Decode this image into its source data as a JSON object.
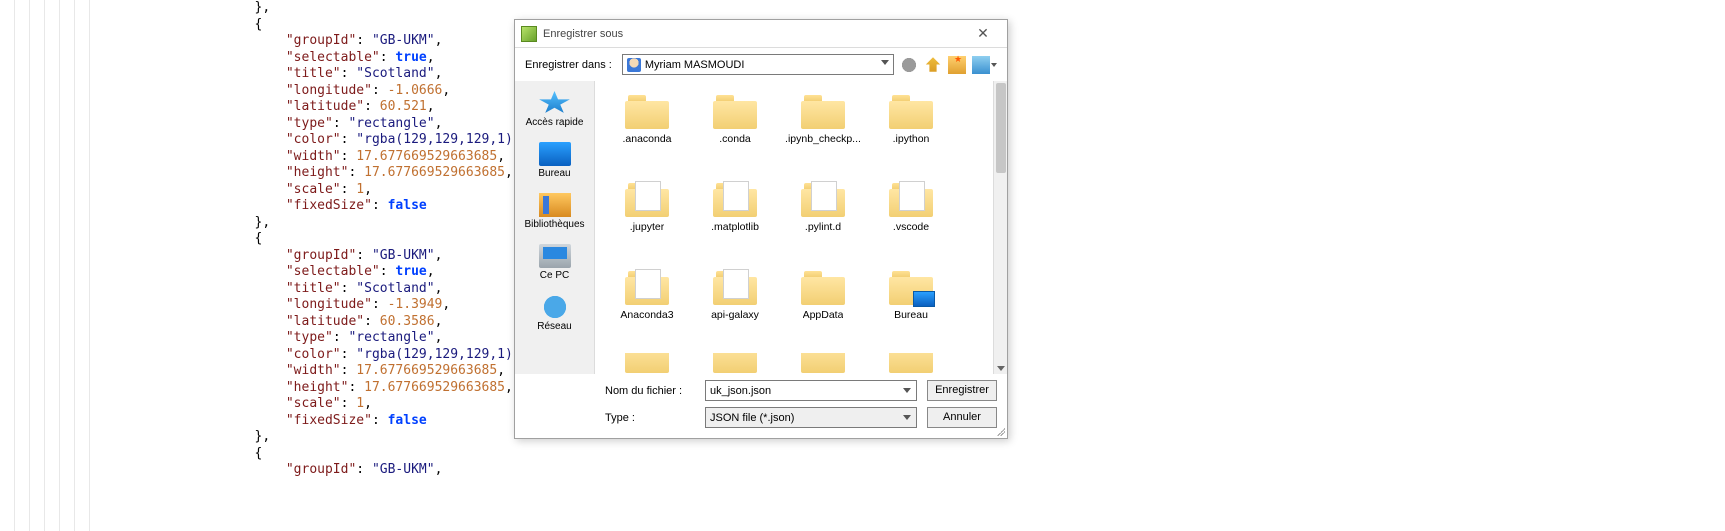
{
  "code": {
    "lines": [
      {
        "t": "},",
        "indent": 5
      },
      {
        "t": "{",
        "indent": 5
      },
      {
        "kv": true,
        "indent": 6,
        "key": "groupId",
        "vtype": "str",
        "v": "GB-UKM"
      },
      {
        "kv": true,
        "indent": 6,
        "key": "selectable",
        "vtype": "bool",
        "v": "true"
      },
      {
        "kv": true,
        "indent": 6,
        "key": "title",
        "vtype": "str",
        "v": "Scotland"
      },
      {
        "kv": true,
        "indent": 6,
        "key": "longitude",
        "vtype": "num",
        "v": "-1.0666"
      },
      {
        "kv": true,
        "indent": 6,
        "key": "latitude",
        "vtype": "num",
        "v": "60.521"
      },
      {
        "kv": true,
        "indent": 6,
        "key": "type",
        "vtype": "str",
        "v": "rectangle"
      },
      {
        "kv": true,
        "indent": 6,
        "key": "color",
        "vtype": "str",
        "v": "rgba(129,129,129,1)"
      },
      {
        "kv": true,
        "indent": 6,
        "key": "width",
        "vtype": "num",
        "v": "17.677669529663685"
      },
      {
        "kv": true,
        "indent": 6,
        "key": "height",
        "vtype": "num",
        "v": "17.677669529663685"
      },
      {
        "kv": true,
        "indent": 6,
        "key": "scale",
        "vtype": "num",
        "v": "1"
      },
      {
        "kv": true,
        "indent": 6,
        "key": "fixedSize",
        "vtype": "bool",
        "v": "false",
        "last": true
      },
      {
        "t": "},",
        "indent": 5
      },
      {
        "t": "{",
        "indent": 5
      },
      {
        "kv": true,
        "indent": 6,
        "key": "groupId",
        "vtype": "str",
        "v": "GB-UKM"
      },
      {
        "kv": true,
        "indent": 6,
        "key": "selectable",
        "vtype": "bool",
        "v": "true"
      },
      {
        "kv": true,
        "indent": 6,
        "key": "title",
        "vtype": "str",
        "v": "Scotland"
      },
      {
        "kv": true,
        "indent": 6,
        "key": "longitude",
        "vtype": "num",
        "v": "-1.3949"
      },
      {
        "kv": true,
        "indent": 6,
        "key": "latitude",
        "vtype": "num",
        "v": "60.3586"
      },
      {
        "kv": true,
        "indent": 6,
        "key": "type",
        "vtype": "str",
        "v": "rectangle"
      },
      {
        "kv": true,
        "indent": 6,
        "key": "color",
        "vtype": "str",
        "v": "rgba(129,129,129,1)"
      },
      {
        "kv": true,
        "indent": 6,
        "key": "width",
        "vtype": "num",
        "v": "17.677669529663685"
      },
      {
        "kv": true,
        "indent": 6,
        "key": "height",
        "vtype": "num",
        "v": "17.677669529663685"
      },
      {
        "kv": true,
        "indent": 6,
        "key": "scale",
        "vtype": "num",
        "v": "1"
      },
      {
        "kv": true,
        "indent": 6,
        "key": "fixedSize",
        "vtype": "bool",
        "v": "false",
        "last": true
      },
      {
        "t": "},",
        "indent": 5
      },
      {
        "t": "{",
        "indent": 5
      },
      {
        "kv": true,
        "indent": 6,
        "key": "groupId",
        "vtype": "str",
        "v": "GB-UKM"
      }
    ]
  },
  "dialog": {
    "title": "Enregistrer sous",
    "save_in_label": "Enregistrer dans :",
    "location": "Myriam MASMOUDI",
    "places": [
      {
        "label": "Accès rapide",
        "pic": "pic-star"
      },
      {
        "label": "Bureau",
        "pic": "pic-desk"
      },
      {
        "label": "Bibliothèques",
        "pic": "pic-lib"
      },
      {
        "label": "Ce PC",
        "pic": "pic-pc"
      },
      {
        "label": "Réseau",
        "pic": "pic-net"
      }
    ],
    "files": [
      {
        "name": ".anaconda",
        "sheet": false
      },
      {
        "name": ".conda",
        "sheet": false
      },
      {
        "name": ".ipynb_checkp...",
        "sheet": false
      },
      {
        "name": ".ipython",
        "sheet": false
      },
      {
        "name": ".jupyter",
        "sheet": true
      },
      {
        "name": ".matplotlib",
        "sheet": true
      },
      {
        "name": ".pylint.d",
        "sheet": true
      },
      {
        "name": ".vscode",
        "sheet": true
      },
      {
        "name": "Anaconda3",
        "sheet": true
      },
      {
        "name": "api-galaxy",
        "sheet": true
      },
      {
        "name": "AppData",
        "sheet": false
      },
      {
        "name": "Bureau",
        "sheet": false,
        "desk": true
      }
    ],
    "filename_label": "Nom du fichier :",
    "filename_value": "uk_json.json",
    "type_label": "Type :",
    "type_value": "JSON file (*.json)",
    "save_btn": "Enregistrer",
    "cancel_btn": "Annuler"
  }
}
